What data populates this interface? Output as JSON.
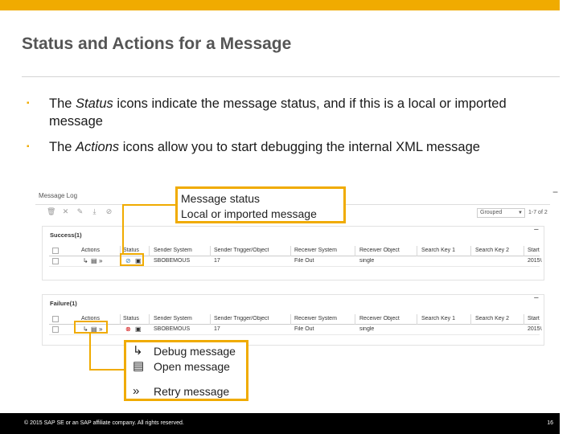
{
  "slide": {
    "title": "Status and Actions for a Message",
    "bullets": [
      {
        "pre": "The ",
        "em": "Status",
        "post": " icons indicate the message status, and if this is a local or imported message"
      },
      {
        "pre": "The ",
        "em": "Actions",
        "post": " icons allow you to start debugging the internal XML message"
      }
    ],
    "bullet_mark": "▪"
  },
  "screenshot": {
    "panel_title": "Message Log",
    "collapse_icon": "minus-icon",
    "toolbar_icons": [
      "trash-icon",
      "delete-icon",
      "edit-icon",
      "download-icon",
      "filter-off-icon"
    ],
    "select_value": "Grouped",
    "pager": "1-7 of 2",
    "columns": [
      "Actions",
      "Status",
      "Sender System",
      "Sender Trigger/Object",
      "Receiver System",
      "Receiver Object",
      "Search Key 1",
      "Search Key 2",
      "Start"
    ],
    "success": {
      "title": "Success(1)",
      "row": {
        "sender_system": "SBOBEMOUS",
        "trigger": "17",
        "receiver_system": "File Out",
        "receiver_object": "single",
        "start": "2015\\"
      }
    },
    "failure": {
      "title": "Failure(1)",
      "row": {
        "sender_system": "SBOBEMOUS",
        "trigger": "17",
        "receiver_system": "File Out",
        "receiver_object": "single",
        "start": "2015\\"
      }
    }
  },
  "callouts": {
    "status_lines": [
      "Message status",
      "Local or imported message"
    ],
    "actions": [
      {
        "icon": "debug-message-icon",
        "label": "Debug message"
      },
      {
        "icon": "open-message-icon",
        "label": "Open message"
      },
      {
        "icon": "retry-message-icon",
        "label": "Retry message"
      }
    ]
  },
  "footer": {
    "copyright": "© 2015 SAP SE or an SAP affiliate company. All rights reserved.",
    "page": "16"
  },
  "colors": {
    "accent": "#f0ab00",
    "footer": "#000000",
    "error": "#d00000",
    "ok": "#3c7fb1"
  }
}
